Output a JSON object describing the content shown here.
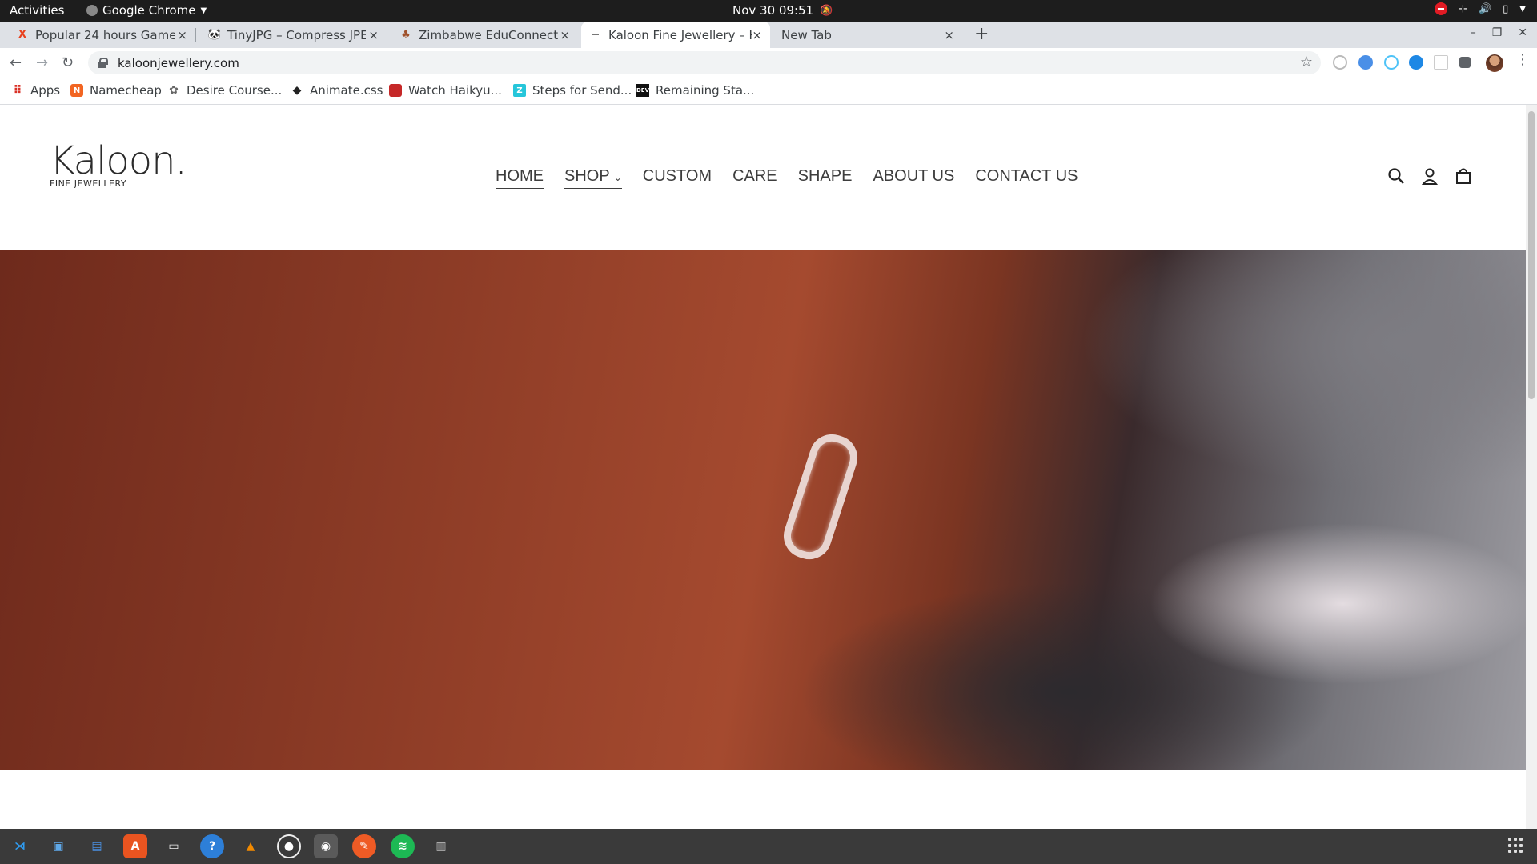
{
  "system": {
    "activities": "Activities",
    "app_name": "Google Chrome",
    "clock": "Nov 30  09:51"
  },
  "tabs": [
    {
      "title": "Popular 24 hours Game To",
      "favicon": "x-red-icon",
      "active": false
    },
    {
      "title": "TinyJPG – Compress JPEG",
      "favicon": "panda-icon",
      "active": false
    },
    {
      "title": "Zimbabwe EduConnect - /",
      "favicon": "zimbabwe-icon",
      "active": false
    },
    {
      "title": "Kaloon Fine Jewellery – K",
      "favicon": "kaloon-icon",
      "active": true
    },
    {
      "title": "New Tab",
      "favicon": "",
      "active": false
    }
  ],
  "omnibox": {
    "url": "kaloonjewellery.com"
  },
  "bookmarks": [
    {
      "label": "Apps",
      "icon": "apps-grid-icon"
    },
    {
      "label": "Namecheap",
      "icon": "namecheap-icon"
    },
    {
      "label": "Desire Course...",
      "icon": "desire-icon"
    },
    {
      "label": "Animate.css",
      "icon": "animate-icon"
    },
    {
      "label": "Watch Haikyu...",
      "icon": "haikyu-icon"
    },
    {
      "label": "Steps for Send...",
      "icon": "steps-icon"
    },
    {
      "label": "Remaining Sta...",
      "icon": "dev-icon"
    }
  ],
  "site": {
    "logo": "Kaloon.",
    "logo_sub": "FINE JEWELLERY",
    "nav": [
      "HOME",
      "SHOP",
      "CUSTOM",
      "CARE",
      "SHAPE",
      "ABOUT US",
      "CONTACT US"
    ]
  },
  "colors": {
    "topbar": "#1d1d1d",
    "tabstrip": "#dee1e6",
    "dock": "#3a3a3a",
    "text_dark": "#3d3d3d"
  }
}
